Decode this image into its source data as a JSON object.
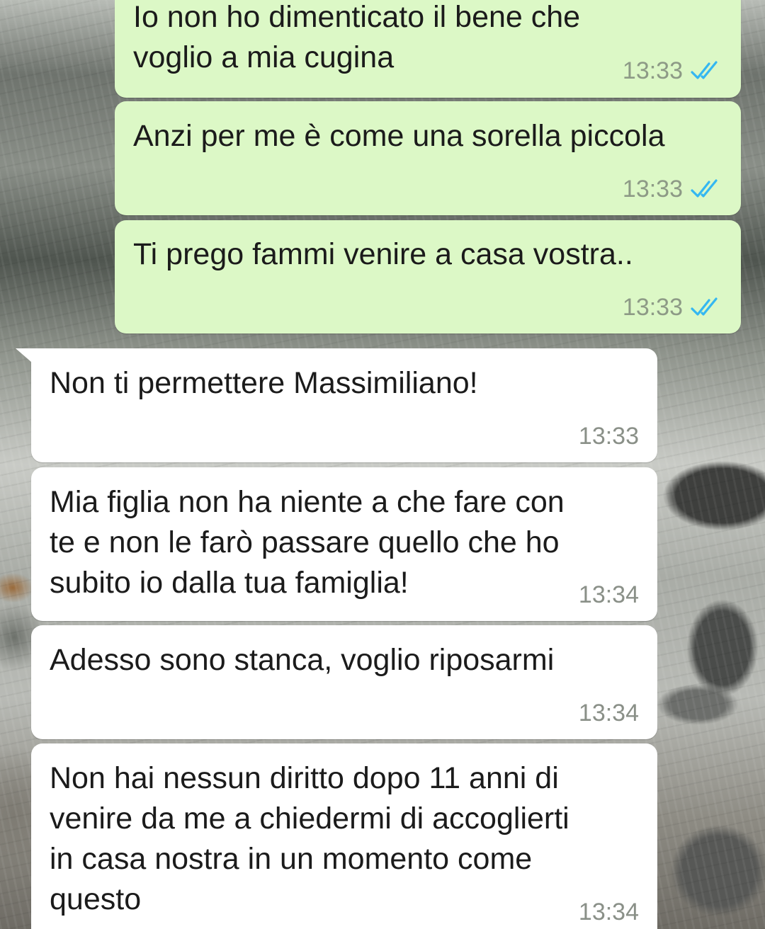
{
  "colors": {
    "outgoing_bubble": "#dcf8c6",
    "incoming_bubble": "#ffffff",
    "read_ticks": "#34b7f1",
    "timestamp": "#8a9088"
  },
  "messages": [
    {
      "direction": "outgoing",
      "text": "Io non ho dimenticato il bene che\nvoglio a mia cugina",
      "time": "13:33",
      "status_icon": "double-check-read-icon"
    },
    {
      "direction": "outgoing",
      "text": "Anzi per me è come una sorella piccola",
      "time": "13:33",
      "status_icon": "double-check-read-icon"
    },
    {
      "direction": "outgoing",
      "text": "Ti prego fammi venire a casa vostra..",
      "time": "13:33",
      "status_icon": "double-check-read-icon"
    },
    {
      "direction": "incoming",
      "text": "Non ti permettere Massimiliano!",
      "time": "13:33"
    },
    {
      "direction": "incoming",
      "text": "Mia figlia non ha niente a che fare con\nte e non le farò passare quello che ho\nsubito io dalla tua famiglia!",
      "time": "13:34"
    },
    {
      "direction": "incoming",
      "text": "Adesso sono stanca, voglio riposarmi",
      "time": "13:34"
    },
    {
      "direction": "incoming",
      "text": "Non hai nessun diritto dopo 11 anni di\nvenire da me a chiedermi di accoglierti\nin casa nostra in un momento come\nquesto",
      "time": "13:34"
    }
  ]
}
